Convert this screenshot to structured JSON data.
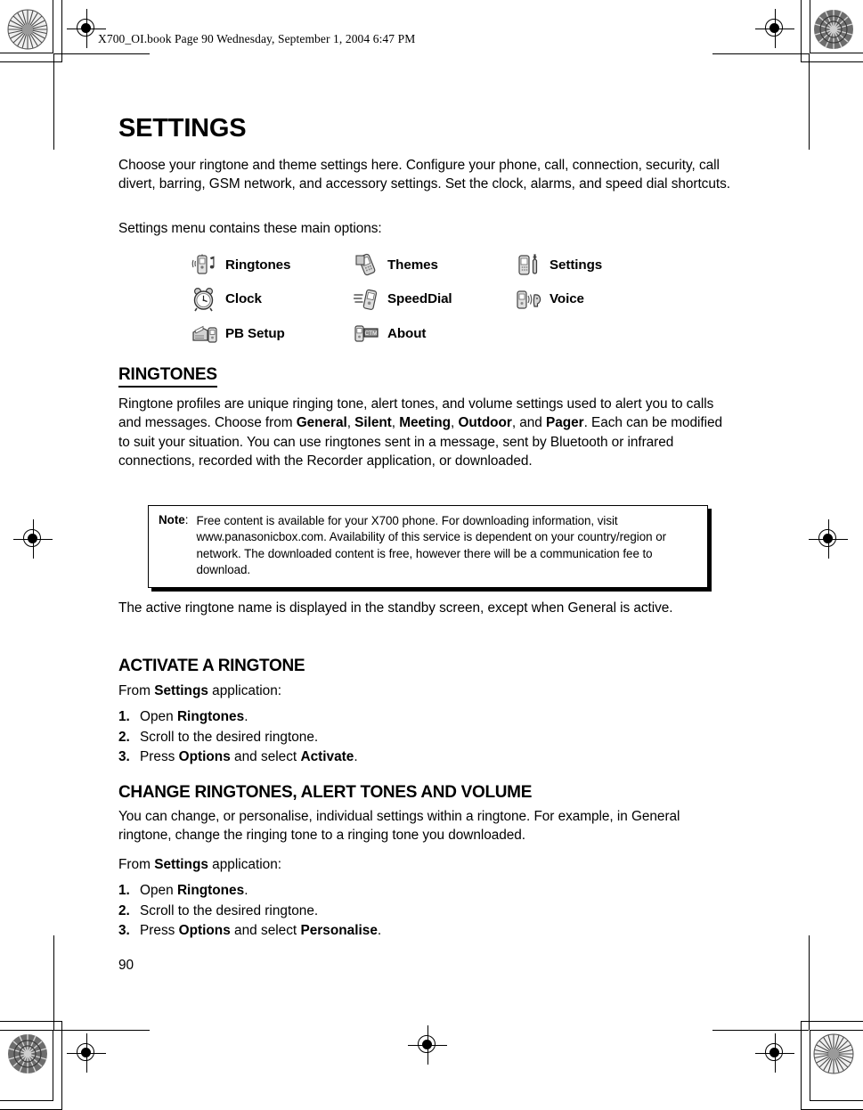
{
  "document": {
    "header_note": "X700_OI.book  Page 90  Wednesday, September 1, 2004  6:47 PM",
    "page_number": "90",
    "title": "SETTINGS"
  },
  "intro": {
    "paragraph_1": "Choose your ringtone and theme settings here. Configure your phone, call, connection, security, call divert, barring, GSM network, and accessory settings. Set the clock, alarms, and speed dial shortcuts.",
    "paragraph_2": "Settings menu contains these main options:"
  },
  "menu": {
    "items": [
      {
        "label": "Ringtones",
        "icon": "phone-ringing-icon"
      },
      {
        "label": "Themes",
        "icon": "phone-theme-icon"
      },
      {
        "label": "Settings",
        "icon": "phone-wrench-icon"
      },
      {
        "label": "Clock",
        "icon": "alarm-clock-icon"
      },
      {
        "label": "SpeedDial",
        "icon": "phone-speed-icon"
      },
      {
        "label": "Voice",
        "icon": "phone-voice-icon"
      },
      {
        "label": "PB Setup",
        "icon": "fax-phone-icon"
      },
      {
        "label": "About",
        "icon": "phone-tag-icon"
      }
    ]
  },
  "ringtones": {
    "heading": "RINGTONES",
    "paragraph_parts": {
      "p1": "Ringtone profiles are unique ringing tone, alert tones, and volume settings used to alert you to calls and messages. Choose from ",
      "b1": "General",
      "p2": ", ",
      "b2": "Silent",
      "p3": ", ",
      "b3": "Meeting",
      "p4": ", ",
      "b4": "Outdoor",
      "p5": ", and ",
      "b5": "Pager",
      "p6": ". Each can be modified to suit your situation. You can use ringtones sent in a message, sent by Bluetooth or infrared connections, recorded with the Recorder application, or downloaded."
    }
  },
  "note": {
    "label": "Note",
    "colon": ":",
    "text": "Free content is available for your X700 phone. For downloading information, visit www.panasonicbox.com. Availability of this service is dependent on your country/region or network. The downloaded content is free, however there will be a communication fee to download."
  },
  "standby": {
    "paragraph": "The active ringtone name is displayed in the standby screen, except when General is active."
  },
  "activate_section": {
    "heading": "ACTIVATE A RINGTONE",
    "from_prefix": "From ",
    "from_bold": "Settings",
    "from_suffix": " application:",
    "steps": [
      {
        "num": "1.",
        "pre": "Open ",
        "bold": "Ringtones",
        "post": "."
      },
      {
        "num": "2.",
        "pre": "Scroll to the desired ringtone.",
        "bold": "",
        "post": ""
      },
      {
        "num": "3.",
        "pre": "Press ",
        "bold": "Options",
        "post": " and select ",
        "bold2": "Activate",
        "post2": "."
      }
    ]
  },
  "change_section": {
    "heading": "CHANGE RINGTONES, ALERT TONES AND VOLUME",
    "paragraph": "You can change, or personalise, individual settings within a ringtone. For example, in General ringtone, change the ringing tone to a ringing tone you downloaded.",
    "from_prefix": "From ",
    "from_bold": "Settings",
    "from_suffix": " application:",
    "steps": [
      {
        "num": "1.",
        "pre": "Open ",
        "bold": "Ringtones",
        "post": "."
      },
      {
        "num": "2.",
        "pre": "Scroll to the desired ringtone.",
        "bold": "",
        "post": ""
      },
      {
        "num": "3.",
        "pre": "Press ",
        "bold": "Options",
        "post": " and select ",
        "bold2": "Personalise",
        "post2": "."
      }
    ]
  }
}
